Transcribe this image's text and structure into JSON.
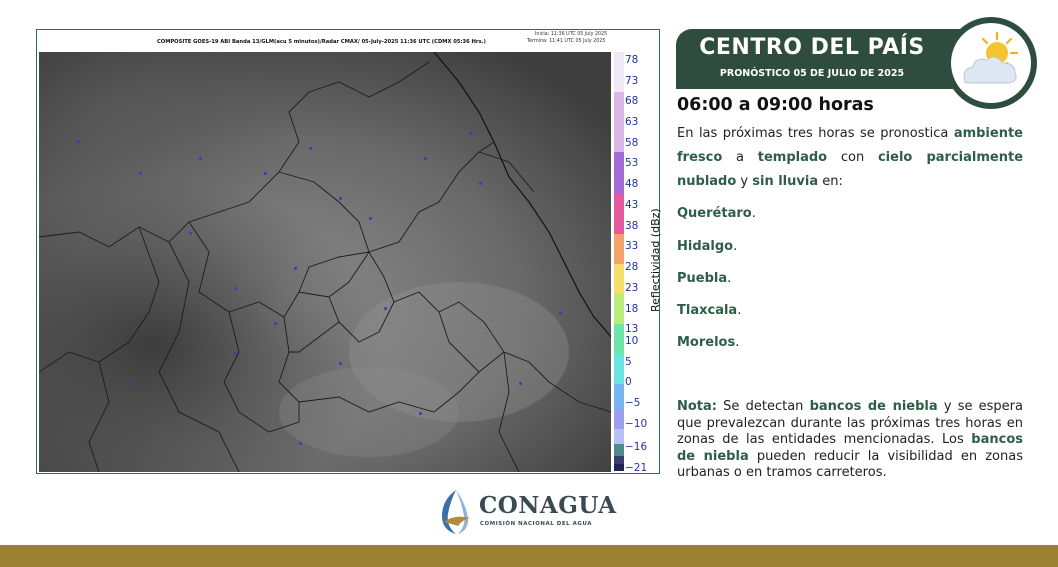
{
  "map": {
    "title": "COMPOSITE GOES-19 ABI Banda 13/GLM(acu 5 minutos)/Radar CMAX/ 05-July-2025 11:36 UTC  (CDMX  05:36 Hrs.)",
    "time_start": "Inicia: 11:36 UTC 05 July 2025",
    "time_end": "Termina: 11:41 UTC 05 July 2025",
    "colorbar_label": "Reflectividad (dBz)",
    "colorbar_ticks": [
      "78",
      "73",
      "68",
      "63",
      "58",
      "53",
      "48",
      "43",
      "38",
      "33",
      "28",
      "23",
      "18",
      "13",
      "10",
      "5",
      "0",
      "−5",
      "−10",
      "−16",
      "−21"
    ]
  },
  "header": {
    "title": "CENTRO DEL PAÍS",
    "subtitle": "PRONÓSTICO 05 DE JULIO DE 2025"
  },
  "forecast": {
    "time_range": "06:00 a 09:00 horas",
    "t1": "En las próximas tres horas se pronostica ",
    "h1": "ambiente fresco",
    "t2": " a ",
    "h2": "templado",
    "t3": " con ",
    "h3": "cielo parcialmente nublado",
    "t4": " y ",
    "h4": "sin lluvia",
    "t5": " en:",
    "states": [
      "Querétaro",
      "Hidalgo",
      "Puebla",
      "Tlaxcala",
      "Morelos"
    ]
  },
  "note": {
    "label": "Nota:",
    "t1": " Se detectan ",
    "h1": "bancos de niebla",
    "t2": " y se espera que prevalezcan durante las próximas tres horas en zonas de las entidades mencionadas. Los ",
    "h2": "bancos de niebla",
    "t3": " pueden reducir la visibilidad en zonas urbanas o en tramos carreteros."
  },
  "footer": {
    "logo_name": "CONAGUA",
    "logo_subtitle": "COMISIÓN NACIONAL DEL AGUA"
  },
  "colors": {
    "header_bg": "#2f4d3e",
    "highlight": "#2f5e48",
    "footer_bar": "#9b8233"
  },
  "icons": {
    "weather": "partly-cloudy-icon",
    "logo": "conagua-logo-icon"
  }
}
